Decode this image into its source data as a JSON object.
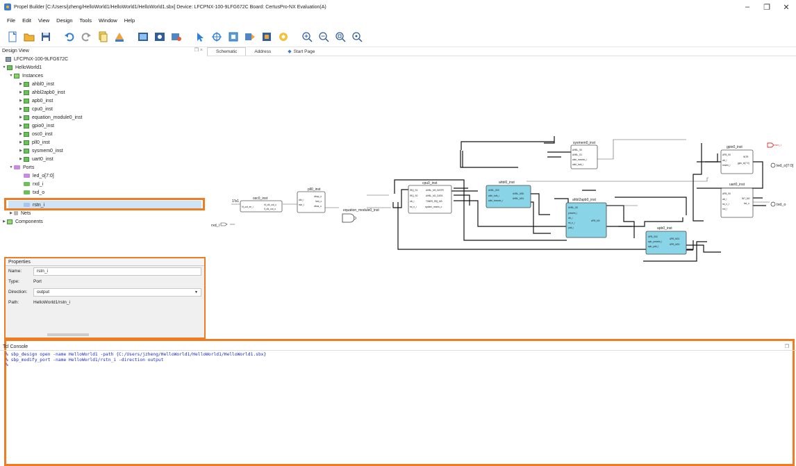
{
  "window": {
    "title": "Propel Builder  [C:/Users/jzheng/HelloWorld1/HelloWorld1/HelloWorld1.sbx]  Device: LFCPNX-100-9LFG672C  Board: CertusPro-NX Evaluation(A)",
    "minimize": "–",
    "maximize": "❐",
    "close": "✕"
  },
  "menu": [
    "File",
    "Edit",
    "View",
    "Design",
    "Tools",
    "Window",
    "Help"
  ],
  "toolbar": {
    "icons": [
      "new-icon",
      "open-icon",
      "save-icon",
      "undo-icon",
      "redo-icon",
      "copy-icon",
      "generate-icon",
      "validate-icon",
      "run-icon",
      "settings-icon",
      "select-icon",
      "pan-icon",
      "fit-icon",
      "refresh-icon",
      "export-icon",
      "config-icon",
      "zoom-in-icon",
      "zoom-out-icon",
      "zoom-area-icon",
      "zoom-fit-icon"
    ]
  },
  "design_view": {
    "title": "Design View",
    "controls": "❐ ×",
    "device": "LFCPNX-100-9LFG672C",
    "project": "HelloWorld1",
    "instances_label": "Instances",
    "instances": [
      "ahbl0_inst",
      "ahbl2apb0_inst",
      "apb0_inst",
      "cpu0_inst",
      "equation_module0_inst",
      "gpio0_inst",
      "osc0_inst",
      "pll0_inst",
      "sysmem0_inst",
      "uart0_inst"
    ],
    "ports_label": "Ports",
    "ports": [
      "led_o[7:0]",
      "rxd_i",
      "txd_o",
      "rstn_i"
    ],
    "nets_label": "Nets",
    "components_label": "Components",
    "selected": "rstn_i"
  },
  "tabs": [
    {
      "label": "Schematic",
      "active": true
    },
    {
      "label": "Address",
      "active": false
    },
    {
      "label": "Start Page",
      "active": false
    }
  ],
  "properties": {
    "title": "Properties",
    "name_label": "Name:",
    "name_value": "rstn_i",
    "type_label": "Type:",
    "type_value": "Port",
    "direction_label": "Direction:",
    "direction_value": "output",
    "path_label": "Path:",
    "path_value": "HelloWorld1/rstn_i"
  },
  "schematic": {
    "blocks": {
      "osc0": {
        "title": "osc0_inst",
        "pins": [
          "hf_out_en_i",
          "hf_clk_out_o",
          "lf_clk_out_o"
        ]
      },
      "pll0": {
        "title": "pll0_inst",
        "pins": [
          "clki_i",
          "rstn_i",
          "clkop_o",
          "lock_o",
          "clkos_o"
        ]
      },
      "eqn": {
        "title": "equation_module0_inst"
      },
      "cpu0": {
        "title": "cpu0_inst",
        "pins": [
          "IRQ_S1",
          "IRQ_S0",
          "clk_i",
          "rst_n_i",
          "AHBL_M0_INSTR",
          "AHBL_M1_DATA",
          "TIMER_IRQ_M0",
          "system_resetn_o"
        ]
      },
      "ahbl0": {
        "title": "ahbl0_inst",
        "pins": [
          "AHBL_S00",
          "ahbl_hclk_i",
          "ahbl_hresetn_i",
          "AHBL_M00",
          "AHBL_M01"
        ]
      },
      "sysmem0": {
        "title": "sysmem0_inst",
        "pins": [
          "AHBL_S0",
          "AHBL_S1",
          "ahbl_hresetn_i",
          "ahbl_hclk_i"
        ]
      },
      "ahbl2apb0": {
        "title": "ahbl2apb0_inst",
        "pins": [
          "AHBL_S0",
          "presetn_i",
          "clk_i",
          "rst_n_i",
          "pclk_i",
          "APB_M0"
        ]
      },
      "apb0": {
        "title": "apb0_inst",
        "pins": [
          "APB_S00",
          "apb_presetn_i",
          "apb_pclk_i",
          "APB_M01",
          "APB_M00"
        ]
      },
      "gpio0": {
        "title": "gpio0_inst",
        "pins": [
          "APB_S0",
          "clk_i",
          "resetn_i",
          "INTR",
          "gpio_io[7:0]"
        ]
      },
      "uart0": {
        "title": "uart0_inst",
        "pins": [
          "APB_S0",
          "clk_i",
          "rst_n_i",
          "INT_M0",
          "txd_o",
          "rxd_i"
        ]
      }
    },
    "ports": {
      "const": "1'b1",
      "rxd_i": "rxd_i",
      "led_o": "led_o[7:0]",
      "txd_o": "txd_o",
      "rstn_i": "rstn_i"
    }
  },
  "tcl": {
    "title": "Tcl Console",
    "lines": [
      "% sbp_design open -name HelloWorld1 -path {C:/Users/jzheng/HelloWorld1/HelloWorld1/HelloWorld1.sbx}",
      "% sbp_modify_port -name HelloWorld1/rstn_i -direction output",
      "%"
    ]
  },
  "colors": {
    "highlight_box": "#f07b21",
    "block_highlight": "#8ad4e8",
    "console_text": "#1b2bc4",
    "error_port": "#e03030"
  }
}
